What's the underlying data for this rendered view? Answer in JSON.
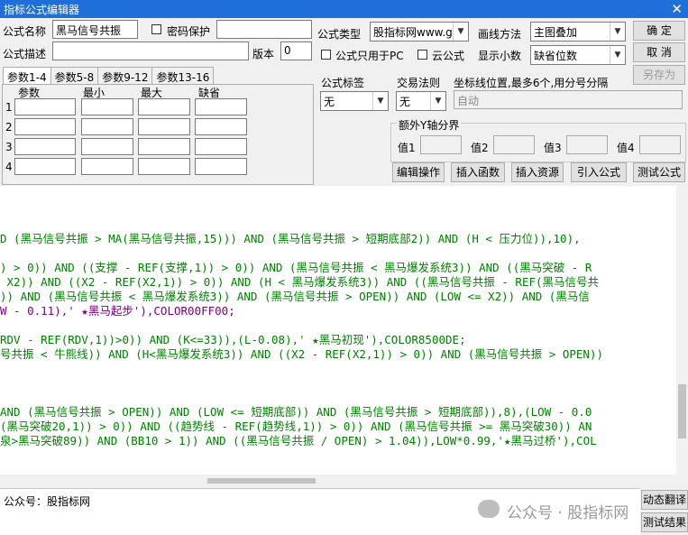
{
  "window": {
    "title": "指标公式编辑器"
  },
  "form": {
    "name_label": "公式名称",
    "name_value": "黑马信号共振",
    "password_label": "密码保护",
    "desc_label": "公式描述",
    "version_label": "版本",
    "version_value": "0",
    "type_label": "公式类型",
    "type_value": "股指标网www.g",
    "draw_label": "画线方法",
    "draw_value": "主图叠加",
    "pc_only_label": "公式只用于PC",
    "cloud_label": "云公式",
    "decimal_label": "显示小数",
    "decimal_value": "缺省位数",
    "tag_label": "公式标签",
    "tag_value": "无",
    "trade_label": "交易法则",
    "trade_value": "无",
    "coord_label": "坐标线位置,最多6个,用分号分隔",
    "coord_value": "自动",
    "extra_axis_label": "额外Y轴分界",
    "val_labels": [
      "值1",
      "值2",
      "值3",
      "值4"
    ]
  },
  "buttons": {
    "ok": "确 定",
    "cancel": "取 消",
    "save_as": "另存为",
    "edit_op": "编辑操作",
    "insert_func": "插入函数",
    "insert_res": "插入资源",
    "import": "引入公式",
    "test": "测试公式",
    "translate": "动态翻译",
    "test_result": "测试结果"
  },
  "params": {
    "tabs": [
      "参数1-4",
      "参数5-8",
      "参数9-12",
      "参数13-16"
    ],
    "headers": [
      "参数",
      "最小",
      "最大",
      "缺省"
    ],
    "rows": [
      "1",
      "2",
      "3",
      "4"
    ]
  },
  "code_lines": [
    "D (黑马信号共振 > MA(黑马信号共振,15))) AND (黑马信号共振 > 短期底部2)) AND (H < 压力位)),10),",
    ") > 0)) AND ((支撑 - REF(支撑,1)) > 0)) AND (黑马信号共振 < 黑马爆发系统3)) AND ((黑马突破 - R",
    " X2)) AND ((X2 - REF(X2,1)) > 0)) AND (H < 黑马爆发系统3)) AND ((黑马信号共振 - REF(黑马信号共",
    ")) AND (黑马信号共振 < 黑马爆发系统3)) AND (黑马信号共振 > OPEN)) AND (LOW <= X2)) AND (黑马信",
    "W - 0.11),' ★黑马起步'),COLOR00FF00;",
    "RDV - REF(RDV,1))>0)) AND (K<=33)),(L-0.08),' ★黑马初现'),COLOR8500DE;",
    "号共振 < 牛熊线)) AND (H<黑马爆发系统3)) AND ((X2 - REF(X2,1)) > 0)) AND (黑马信号共振 > OPEN))",
    "AND (黑马信号共振 > OPEN)) AND (LOW <= 短期底部)) AND (黑马信号共振 > 短期底部)),8),(LOW - 0.0",
    "(黑马突破20,1)) > 0)) AND ((趋势线 - REF(趋势线,1)) > 0)) AND (黑马信号共振 >= 黑马突破30)) AN",
    "泉>黑马突破89)) AND (BB10 > 1)) AND ((黑马信号共振 / OPEN) > 1.04)),LOW*0.99,'★黑马过桥'),COL"
  ],
  "bottom": {
    "text": "公众号：股指标网",
    "watermark": "公众号 · 股指标网"
  }
}
